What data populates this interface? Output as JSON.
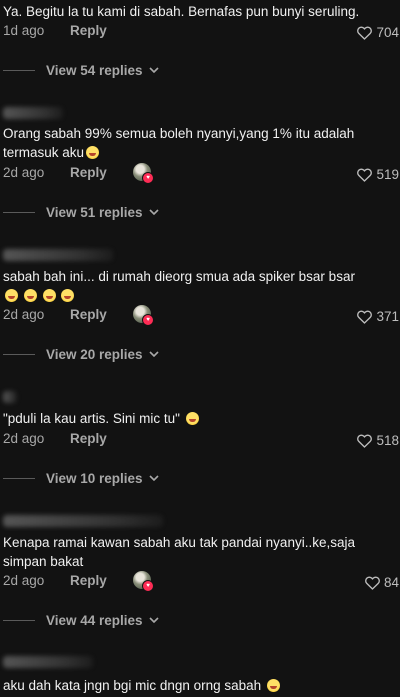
{
  "comments": [
    {
      "text": "Ya. Begitu la tu kami di sabah. Bernafas pun bunyi seruling.",
      "age": "1d ago",
      "reply_label": "Reply",
      "likes": "704",
      "view_replies": "View 54 replies"
    },
    {
      "text": "Orang sabah 99% semua boleh nyanyi,yang 1% itu adalah termasuk aku",
      "age": "2d ago",
      "reply_label": "Reply",
      "likes": "519",
      "view_replies": "View 51 replies"
    },
    {
      "text": "sabah bah ini... di rumah dieorg smua ada spiker bsar bsar",
      "age": "2d ago",
      "reply_label": "Reply",
      "likes": "371",
      "view_replies": "View 20 replies"
    },
    {
      "text": "\"pduli la kau artis. Sini mic tu\"",
      "age": "2d ago",
      "reply_label": "Reply",
      "likes": "518",
      "view_replies": "View 10 replies"
    },
    {
      "text": "Kenapa ramai kawan sabah aku tak pandai nyanyi..ke,saja simpan bakat",
      "age": "2d ago",
      "reply_label": "Reply",
      "likes": "84",
      "view_replies": "View 44 replies"
    },
    {
      "text": "aku dah kata jngn bgi mic dngn orng sabah"
    }
  ],
  "colors": {
    "background": "#121212",
    "secondary_text": "#a8a8a8",
    "like_badge": "#fe2c55"
  },
  "icons": {
    "like": "heart-outline-icon",
    "expand": "chevron-down-icon",
    "creator_liked": "creator-avatar-with-heart-icon"
  }
}
